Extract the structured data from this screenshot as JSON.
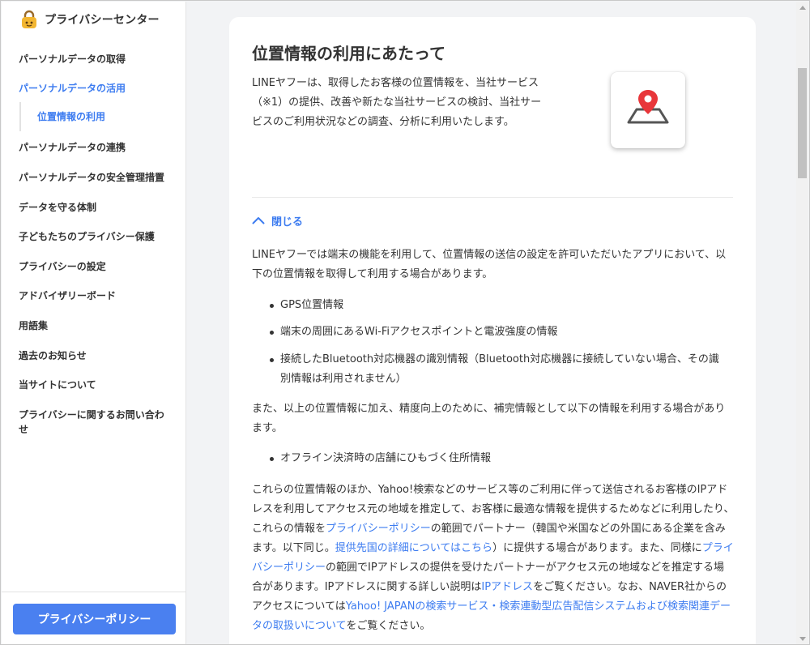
{
  "sidebar": {
    "logo_text": "プライバシーセンター",
    "items": [
      {
        "label": "パーソナルデータの取得"
      },
      {
        "label": "パーソナルデータの活用"
      },
      {
        "label": "パーソナルデータの連携"
      },
      {
        "label": "パーソナルデータの安全管理措置"
      },
      {
        "label": "データを守る体制"
      },
      {
        "label": "子どもたちのプライバシー保護"
      },
      {
        "label": "プライバシーの設定"
      },
      {
        "label": "アドバイザリーボード"
      },
      {
        "label": "用語集"
      },
      {
        "label": "過去のお知らせ"
      },
      {
        "label": "当サイトについて"
      },
      {
        "label": "プライバシーに関するお問い合わせ"
      }
    ],
    "sub_item": "位置情報の利用",
    "privacy_policy_button": "プライバシーポリシー"
  },
  "main": {
    "title": "位置情報の利用にあたって",
    "intro": "LINEヤフーは、取得したお客様の位置情報を、当社サービス（※1）の提供、改善や新たな当社サービスの検討、当社サービスのご利用状況などの調査、分析に利用いたします。",
    "toggle_label": "閉じる",
    "para1": "LINEヤフーでは端末の機能を利用して、位置情報の送信の設定を許可いただいたアプリにおいて、以下の位置情報を取得して利用する場合があります。",
    "bullets1": [
      "GPS位置情報",
      "端末の周囲にあるWi-Fiアクセスポイントと電波強度の情報",
      "接続したBluetooth対応機器の識別情報（Bluetooth対応機器に接続していない場合、その識別情報は利用されません）"
    ],
    "para2": "また、以上の位置情報に加え、精度向上のために、補完情報として以下の情報を利用する場合があります。",
    "bullets2": [
      "オフライン決済時の店舗にひもづく住所情報"
    ],
    "para3": {
      "t1": "これらの位置情報のほか、Yahoo!検索などのサービス等のご利用に伴って送信されるお客様のIPアドレスを利用してアクセス元の地域を推定して、お客様に最適な情報を提供するためなどに利用したり、これらの情報を",
      "link1": "プライバシーポリシー",
      "t2": "の範囲でパートナー（韓国や米国などの外国にある企業を含みます。以下同じ。",
      "link2": "提供先国の詳細についてはこちら",
      "t3": "）に提供する場合があります。また、同様に",
      "link3": "プライバシーポリシー",
      "t4": "の範囲でIPアドレスの提供を受けたパートナーがアクセス元の地域などを推定する場合があります。IPアドレスに関する詳しい説明は",
      "link4": "IPアドレス",
      "t5": "をご覧ください。なお、NAVER社からのアクセスについては",
      "link5": "Yahoo! JAPANの検索サービス・検索連動型広告配信システムおよび検索関連データの取扱いについて",
      "t6": "をご覧ください。"
    }
  },
  "colors": {
    "accent": "#3d7cf0",
    "button": "#4a80f0",
    "pin": "#e8363a"
  }
}
